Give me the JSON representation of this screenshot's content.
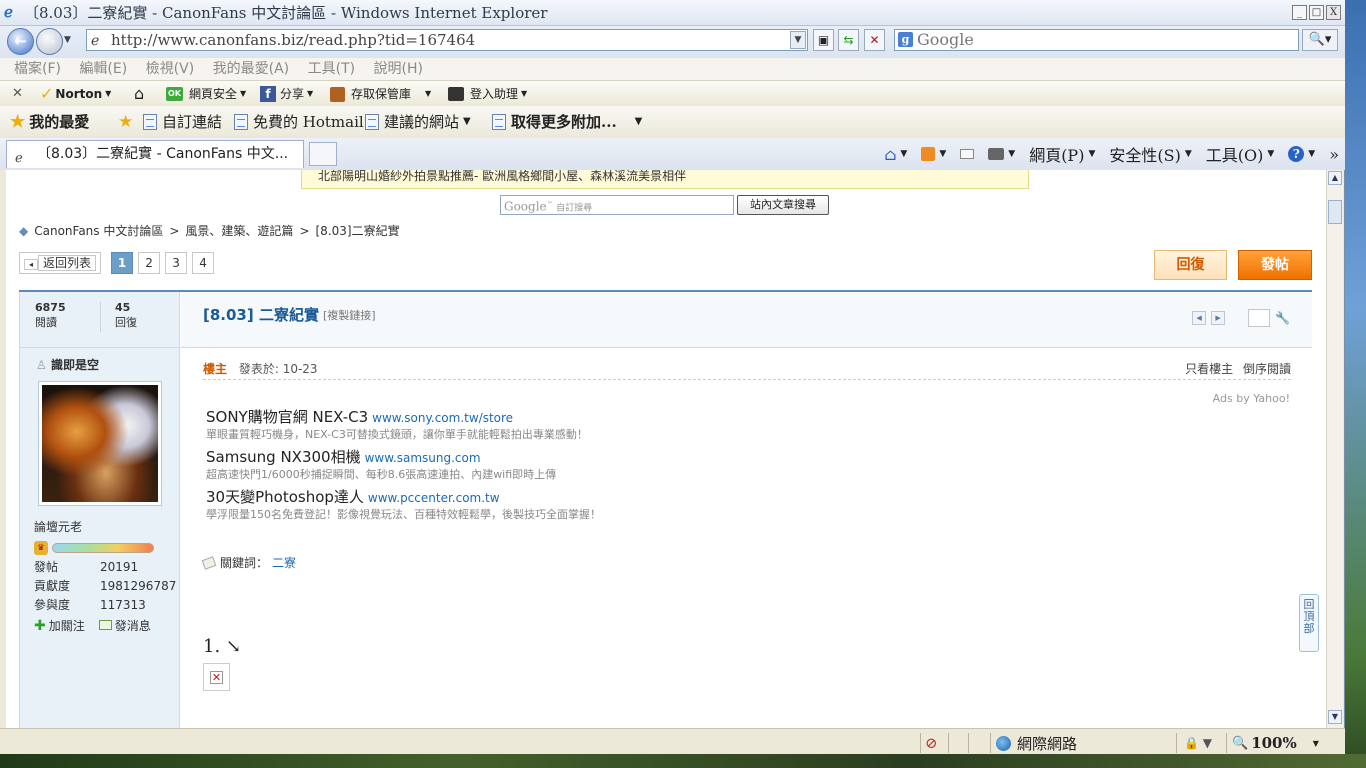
{
  "window": {
    "title": "〔8.03〕二寮紀實 - CanonFans 中文討論區 - Windows Internet Explorer",
    "controls": [
      "_",
      "□",
      "X"
    ]
  },
  "address_bar": {
    "url": "http://www.canonfans.biz/read.php?tid=167464",
    "search_placeholder": "Google"
  },
  "menu": [
    "檔案(F)",
    "編輯(E)",
    "檢視(V)",
    "我的最愛(A)",
    "工具(T)",
    "說明(H)"
  ],
  "norton_toolbar": {
    "norton": "Norton",
    "web_safety": "網頁安全",
    "share": "分享",
    "vault": "存取保管庫",
    "login_assist": "登入助理"
  },
  "favorites_bar": {
    "favorites": "我的最愛",
    "items": [
      "自訂連結",
      "免費的 Hotmail",
      "建議的網站",
      "取得更多附加..."
    ]
  },
  "tabs": {
    "active": "〔8.03〕二寮紀實 - CanonFans 中文..."
  },
  "command_bar": {
    "page": "網頁(P)",
    "safety": "安全性(S)",
    "tools": "工具(O)",
    "more": "»"
  },
  "page": {
    "notice": "北部陽明山婚紗外拍景點推薦- 歐洲風格鄉間小屋、森林溪流美景相伴",
    "search_placeholder_brand": "Google",
    "search_placeholder_label": "自訂搜尋",
    "search_button": "站內文章搜尋",
    "breadcrumb": [
      "CanonFans 中文討論區",
      "風景、建築、遊記篇",
      "[8.03]二寮紀實"
    ],
    "breadcrumb_sep": ">",
    "back_label": "返回列表",
    "pages": [
      "1",
      "2",
      "3",
      "4"
    ],
    "reply_button": "回復",
    "post_button": "發帖",
    "stats": {
      "views_value": "6875",
      "views_label": "閱讀",
      "replies_value": "45",
      "replies_label": "回復"
    },
    "user": {
      "name": "識即是空",
      "rank": "論壇元老",
      "posts_label": "發帖",
      "posts_value": "20191",
      "contrib_label": "貢獻度",
      "contrib_value": "1981296787",
      "partic_label": "參與度",
      "partic_value": "117313",
      "follow": "加關注",
      "message": "發消息"
    },
    "post": {
      "title": "[8.03] 二寮紀實",
      "copy_link": "[複製鏈接]",
      "author_tag": "樓主",
      "published": "發表於: 10-23",
      "only_author": "只看樓主",
      "reverse": "倒序閱讀",
      "ads_by": "Ads by Yahoo!",
      "ads": [
        {
          "title": "SONY購物官網 NEX-C3",
          "url": "www.sony.com.tw/store",
          "desc": "單眼畫質輕巧機身，NEX-C3可替換式鏡頭，讓你單手就能輕鬆拍出專業感動！"
        },
        {
          "title": "Samsung NX300相機",
          "url": "www.samsung.com",
          "desc": "超高速快門1/6000秒捕捉瞬間、每秒8.6張高速連拍、內建wifi即時上傳"
        },
        {
          "title": "30天變Photoshop達人",
          "url": "www.pccenter.com.tw",
          "desc": "學浮限量150名免費登記！影像視覺玩法、百種特效輕鬆學，後製技巧全面掌握！"
        }
      ],
      "keyword_label": "關鍵詞：",
      "keyword_value": "二寮",
      "content_line": "1. ↘"
    },
    "back_to_top": "回頂部"
  },
  "status_bar": {
    "zone": "網際網路",
    "zoom": "100%"
  }
}
